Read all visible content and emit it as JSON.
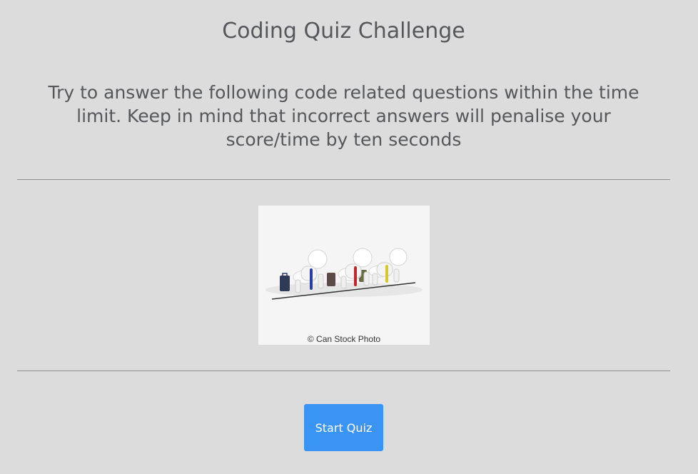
{
  "header": {
    "title": "Coding Quiz Challenge"
  },
  "intro": {
    "text": "Try to answer the following code related questions within the time limit. Keep in mind that incorrect answers will penalise your score/time by ten seconds"
  },
  "hero_image": {
    "caption": "© Can Stock Photo"
  },
  "actions": {
    "start_label": "Start Quiz"
  },
  "colors": {
    "background": "#dcdcdc",
    "text": "#55575a",
    "button": "#3a94f3",
    "button_text": "#ffffff"
  }
}
